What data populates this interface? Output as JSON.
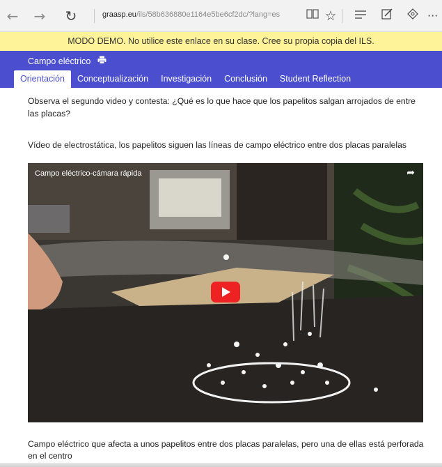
{
  "browser": {
    "url_domain": "graasp.eu",
    "url_path": "/ils/58b636880e1164e5be6cf2dc/?lang=es",
    "icons": [
      "back-arrow-icon",
      "forward-arrow-icon",
      "refresh-icon",
      "reading-view-icon",
      "favorite-star-icon",
      "hub-icon",
      "web-note-icon",
      "share-icon",
      "more-icon"
    ]
  },
  "banner": {
    "text": "MODO DEMO. No utilice este enlace en su clase. Cree su propia copia del ILS."
  },
  "header": {
    "title": "Campo eléctrico",
    "tabs": [
      {
        "label": "Orientación",
        "active": true
      },
      {
        "label": "Conceptualización",
        "active": false
      },
      {
        "label": "Investigación",
        "active": false
      },
      {
        "label": "Conclusión",
        "active": false
      },
      {
        "label": "Student Reflection",
        "active": false
      }
    ]
  },
  "content": {
    "question": "Observa el segundo video y contesta: ¿Qué es lo que hace que los papelitos salgan arrojados de entre las placas?",
    "video_caption": "Vídeo de electrostática, los papelitos siguen las líneas de campo eléctrico entre dos placas paralelas",
    "video_title": "Campo eléctrico-cámara rápida",
    "bottom_text": "Campo eléctrico que afecta a unos papelitos entre dos placas paralelas, pero una de ellas está perforada en el centro"
  },
  "colors": {
    "header": "#4b4fcf",
    "banner": "#fff39a",
    "play": "#e22222"
  }
}
